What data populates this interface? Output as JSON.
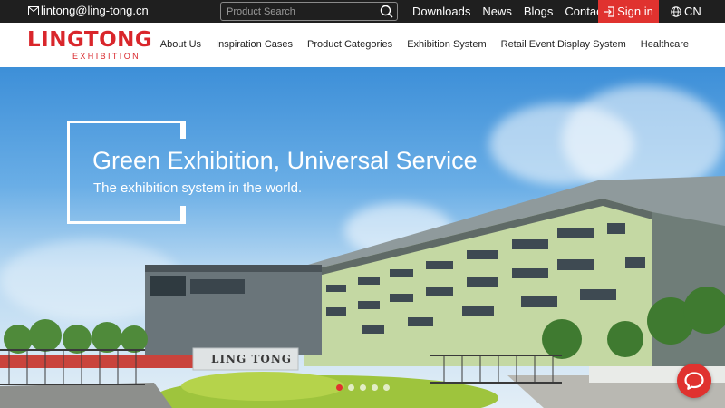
{
  "topbar": {
    "email": "lintong@ling-tong.cn",
    "search_placeholder": "Product Search",
    "links": [
      "Downloads",
      "News",
      "Blogs",
      "Contact"
    ],
    "signin": "Sign in",
    "language": "CN"
  },
  "header": {
    "logo_main": "LINGTONG",
    "logo_sub": "EXHIBITION",
    "nav": [
      "About Us",
      "Inspiration Cases",
      "Product Categories",
      "Exhibition System",
      "Retail Event Display System",
      "Healthcare"
    ]
  },
  "hero": {
    "title": "Green Exhibition, Universal Service",
    "subtitle": "The exhibition system in the world.",
    "sign_text": "LING TONG",
    "slides": 5,
    "active_slide": 1
  },
  "colors": {
    "accent": "#e0322f",
    "topbar": "#1f1f1f",
    "logo": "#d9262b"
  }
}
